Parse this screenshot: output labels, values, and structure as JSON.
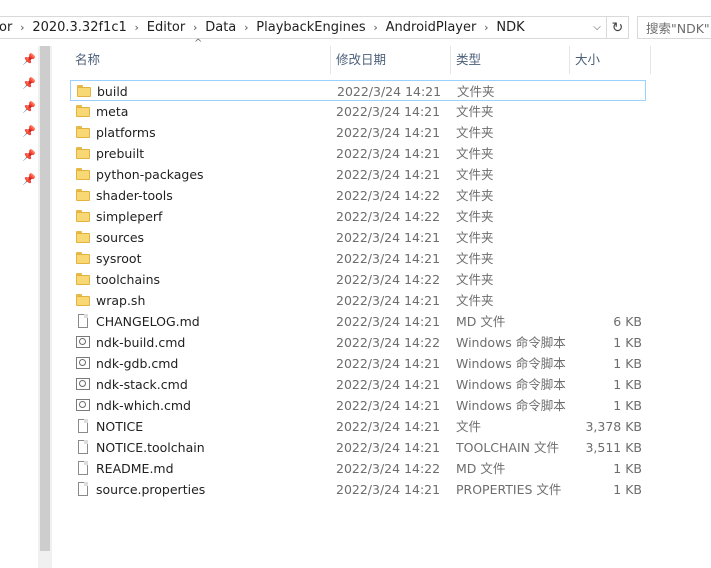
{
  "address": {
    "segments": [
      "or",
      "2020.3.32f1c1",
      "Editor",
      "Data",
      "PlaybackEngines",
      "AndroidPlayer",
      "NDK"
    ],
    "separator": "›",
    "dropdown_glyph": "⌵",
    "refresh_glyph": "↻"
  },
  "search": {
    "placeholder": "搜索\"NDK\""
  },
  "columns": {
    "name": "名称",
    "date": "修改日期",
    "type": "类型",
    "size": "大小"
  },
  "sort_glyph": "^",
  "nav": {
    "pin_glyph": "📌",
    "pin_count": 6
  },
  "files": [
    {
      "name": "build",
      "date": "2022/3/24 14:21",
      "type": "文件夹",
      "size": "",
      "icon": "folder",
      "selected": true
    },
    {
      "name": "meta",
      "date": "2022/3/24 14:21",
      "type": "文件夹",
      "size": "",
      "icon": "folder"
    },
    {
      "name": "platforms",
      "date": "2022/3/24 14:21",
      "type": "文件夹",
      "size": "",
      "icon": "folder"
    },
    {
      "name": "prebuilt",
      "date": "2022/3/24 14:21",
      "type": "文件夹",
      "size": "",
      "icon": "folder"
    },
    {
      "name": "python-packages",
      "date": "2022/3/24 14:21",
      "type": "文件夹",
      "size": "",
      "icon": "folder"
    },
    {
      "name": "shader-tools",
      "date": "2022/3/24 14:22",
      "type": "文件夹",
      "size": "",
      "icon": "folder"
    },
    {
      "name": "simpleperf",
      "date": "2022/3/24 14:22",
      "type": "文件夹",
      "size": "",
      "icon": "folder"
    },
    {
      "name": "sources",
      "date": "2022/3/24 14:21",
      "type": "文件夹",
      "size": "",
      "icon": "folder"
    },
    {
      "name": "sysroot",
      "date": "2022/3/24 14:21",
      "type": "文件夹",
      "size": "",
      "icon": "folder"
    },
    {
      "name": "toolchains",
      "date": "2022/3/24 14:22",
      "type": "文件夹",
      "size": "",
      "icon": "folder"
    },
    {
      "name": "wrap.sh",
      "date": "2022/3/24 14:21",
      "type": "文件夹",
      "size": "",
      "icon": "folder"
    },
    {
      "name": "CHANGELOG.md",
      "date": "2022/3/24 14:21",
      "type": "MD 文件",
      "size": "6 KB",
      "icon": "file"
    },
    {
      "name": "ndk-build.cmd",
      "date": "2022/3/24 14:22",
      "type": "Windows 命令脚本",
      "size": "1 KB",
      "icon": "cmd"
    },
    {
      "name": "ndk-gdb.cmd",
      "date": "2022/3/24 14:21",
      "type": "Windows 命令脚本",
      "size": "1 KB",
      "icon": "cmd"
    },
    {
      "name": "ndk-stack.cmd",
      "date": "2022/3/24 14:21",
      "type": "Windows 命令脚本",
      "size": "1 KB",
      "icon": "cmd"
    },
    {
      "name": "ndk-which.cmd",
      "date": "2022/3/24 14:21",
      "type": "Windows 命令脚本",
      "size": "1 KB",
      "icon": "cmd"
    },
    {
      "name": "NOTICE",
      "date": "2022/3/24 14:21",
      "type": "文件",
      "size": "3,378 KB",
      "icon": "file"
    },
    {
      "name": "NOTICE.toolchain",
      "date": "2022/3/24 14:21",
      "type": "TOOLCHAIN 文件",
      "size": "3,511 KB",
      "icon": "file"
    },
    {
      "name": "README.md",
      "date": "2022/3/24 14:22",
      "type": "MD 文件",
      "size": "1 KB",
      "icon": "file"
    },
    {
      "name": "source.properties",
      "date": "2022/3/24 14:21",
      "type": "PROPERTIES 文件",
      "size": "1 KB",
      "icon": "file"
    }
  ]
}
